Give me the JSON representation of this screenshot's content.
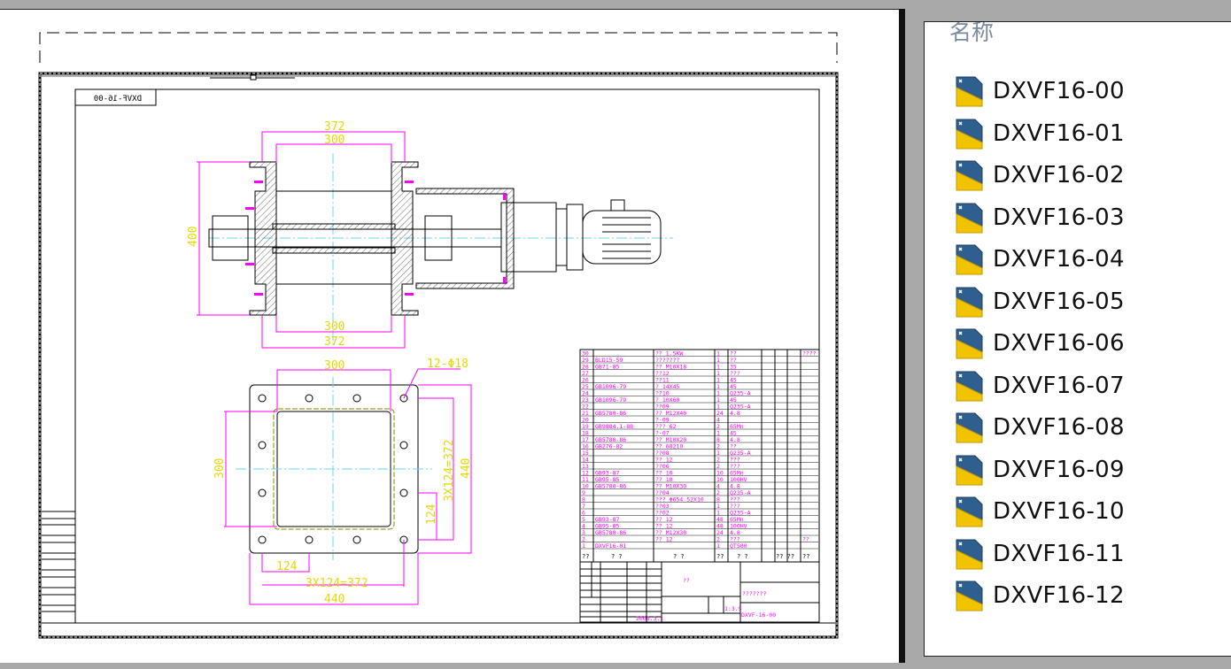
{
  "drawing": {
    "mirrored_label": "DXVF-16-00",
    "side_view": {
      "dim_top_outer": "372",
      "dim_top_inner": "300",
      "dim_height": "400",
      "dim_bottom_inner": "300",
      "dim_bottom_outer": "372"
    },
    "plan_view": {
      "dim_top": "300",
      "dim_holes": "12-Φ18",
      "dim_left": "300",
      "dim_right_pitch": "3X124=372",
      "dim_right_overall": "440",
      "dim_right_single": "124",
      "dim_bottom_single": "124",
      "dim_bottom_pitch": "3X124=372",
      "dim_bottom_overall": "440"
    },
    "parts": [
      [
        "30",
        "",
        "?? 1.5KW",
        "1",
        "??",
        "????"
      ],
      [
        "29",
        "BLD15-59",
        "???????",
        "1",
        "??",
        ""
      ],
      [
        "28",
        "GB71-85",
        "?? M10X18",
        "1",
        "35",
        ""
      ],
      [
        "27",
        "",
        "??12",
        "1",
        "???",
        ""
      ],
      [
        "26",
        "",
        "??11",
        "1",
        "45",
        ""
      ],
      [
        "25",
        "GB1096-79",
        "? 14X45",
        "1",
        "45",
        ""
      ],
      [
        "24",
        "",
        "??10",
        "1",
        "Q235-A",
        ""
      ],
      [
        "23",
        "GB1096-79",
        "? 10X60",
        "1",
        "45",
        ""
      ],
      [
        "22",
        "",
        "??09",
        "1",
        "Q235-A",
        ""
      ],
      [
        "21",
        "GB5780-86",
        "?? M12X40",
        "24",
        "4.8",
        ""
      ],
      [
        "20",
        "",
        "?-09",
        "4",
        "",
        ""
      ],
      [
        "19",
        "GB9884.1-88",
        "???  62",
        "2",
        "65Mn",
        ""
      ],
      [
        "18",
        "",
        "?-07",
        "1",
        "45",
        ""
      ],
      [
        "17",
        "GB5780-86",
        "?? M10X20",
        "8",
        "4.8",
        ""
      ],
      [
        "16",
        "GB276-82",
        "?? 60210",
        "2",
        "??",
        ""
      ],
      [
        "15",
        "",
        "??08",
        "1",
        "Q235-A",
        ""
      ],
      [
        "14",
        "",
        "?? 12",
        "2",
        "???",
        ""
      ],
      [
        "13",
        "",
        "??06",
        "2",
        "???",
        ""
      ],
      [
        "12",
        "GB93-87",
        "?? 10",
        "10",
        "65Mn",
        ""
      ],
      [
        "11",
        "GB95-85",
        "?? 10",
        "10",
        "100HV",
        ""
      ],
      [
        "10",
        "GB5780-86",
        "?? M10X30",
        "4",
        "4.8",
        ""
      ],
      [
        "9",
        "",
        "??04",
        "2",
        "Q235-A",
        ""
      ],
      [
        "8",
        "",
        "??? Φ654 52X10",
        "8",
        "???",
        ""
      ],
      [
        "7",
        "",
        "??03",
        "1",
        "???",
        ""
      ],
      [
        "6",
        "",
        "??02",
        "1",
        "Q235-A",
        ""
      ],
      [
        "5",
        "GB93-87",
        "?? 12",
        "48",
        "65Mn",
        ""
      ],
      [
        "4",
        "GB95-85",
        "?? 12",
        "48",
        "100HV",
        ""
      ],
      [
        "3",
        "GB5780-86",
        "?? M12X30",
        "24",
        "4.8",
        ""
      ],
      [
        "2",
        "",
        "?? 12",
        "2",
        "???",
        "??"
      ],
      [
        "1",
        "DXVF16-01",
        "",
        "1",
        "QT500",
        ""
      ]
    ],
    "parts_header": [
      "??",
      "? ?",
      "? ?",
      "??",
      "? ?",
      "?? ??",
      "??"
    ],
    "title_block": {
      "center": "??",
      "company": "???????",
      "drawing_no": "DXVF-16-00",
      "scale": "1:3.5",
      "date": "2008.3.1"
    }
  },
  "file_list": {
    "header": "名称",
    "items": [
      "DXVF16-00",
      "DXVF16-01",
      "DXVF16-02",
      "DXVF16-03",
      "DXVF16-04",
      "DXVF16-05",
      "DXVF16-06",
      "DXVF16-07",
      "DXVF16-08",
      "DXVF16-09",
      "DXVF16-10",
      "DXVF16-11",
      "DXVF16-12"
    ]
  }
}
